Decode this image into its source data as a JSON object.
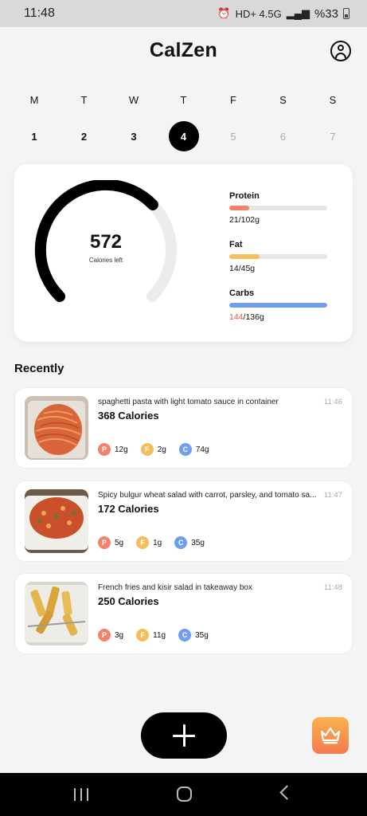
{
  "status_bar": {
    "time": "11:48",
    "indicators": "HD+ 4.5G",
    "battery": "%33"
  },
  "app": {
    "title": "CalZen",
    "profile_icon": "user-circle-icon"
  },
  "week": {
    "days": [
      {
        "letter": "M",
        "num": "1",
        "state": "past"
      },
      {
        "letter": "T",
        "num": "2",
        "state": "past"
      },
      {
        "letter": "W",
        "num": "3",
        "state": "past"
      },
      {
        "letter": "T",
        "num": "4",
        "state": "active"
      },
      {
        "letter": "F",
        "num": "5",
        "state": "future"
      },
      {
        "letter": "S",
        "num": "6",
        "state": "future"
      },
      {
        "letter": "S",
        "num": "7",
        "state": "future"
      }
    ]
  },
  "summary": {
    "calories_left": "572",
    "calories_label": "Calories left",
    "gauge_fraction": 0.67,
    "macros": [
      {
        "name": "Protein",
        "consumed": "21",
        "total": "/102g",
        "fraction": 0.206,
        "color": "#f2836b",
        "over": false
      },
      {
        "name": "Fat",
        "consumed": "14",
        "total": "/45g",
        "fraction": 0.311,
        "color": "#f5be5c",
        "over": false
      },
      {
        "name": "Carbs",
        "consumed": "144",
        "total": "/136g",
        "fraction": 1.0,
        "color": "#6f9ef0",
        "over": true
      }
    ]
  },
  "recently": {
    "title": "Recently",
    "meals": [
      {
        "name": "spaghetti pasta with light tomato sauce in container",
        "time": "11:46",
        "calories": "368 Calories",
        "protein": "12g",
        "fat": "2g",
        "carbs": "74g",
        "image": "spaghetti-photo"
      },
      {
        "name": "Spicy bulgur wheat salad with carrot, parsley, and tomato sa...",
        "time": "11:47",
        "calories": "172 Calories",
        "protein": "5g",
        "fat": "1g",
        "carbs": "35g",
        "image": "bulgur-salad-photo"
      },
      {
        "name": "French fries and kisir salad in takeaway box",
        "time": "11:48",
        "calories": "250 Calories",
        "protein": "3g",
        "fat": "11g",
        "carbs": "35g",
        "image": "fries-photo"
      }
    ],
    "badges": {
      "protein": "P",
      "fat": "F",
      "carbs": "C"
    }
  },
  "colors": {
    "protein": "#f2836b",
    "fat": "#f5be5c",
    "carbs": "#6f9ef0",
    "accent": "#000000"
  },
  "actions": {
    "add_icon": "plus-icon",
    "premium_icon": "crown-icon"
  }
}
